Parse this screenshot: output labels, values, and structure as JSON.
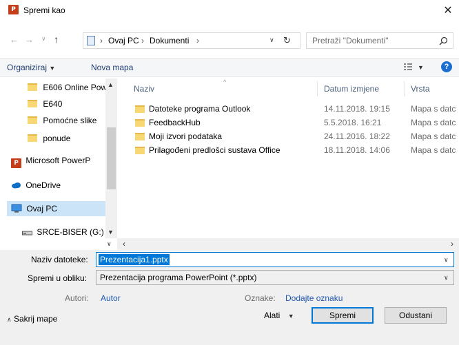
{
  "window": {
    "title": "Spremi kao",
    "app_icon": "powerpoint-icon",
    "close": "✕"
  },
  "nav": {
    "breadcrumb": [
      "Ovaj PC",
      "Dokumenti"
    ],
    "search_placeholder": "Pretraži \"Dokumenti\""
  },
  "toolbar": {
    "organize": "Organiziraj",
    "new_folder": "Nova mapa",
    "help": "?"
  },
  "sidebar": {
    "items": [
      {
        "label": "E606 Online Pow",
        "icon": "folder-icon"
      },
      {
        "label": "E640",
        "icon": "folder-icon"
      },
      {
        "label": "Pomoćne slike",
        "icon": "folder-icon"
      },
      {
        "label": "ponude",
        "icon": "folder-icon"
      },
      {
        "label": "Microsoft PowerP",
        "icon": "powerpoint-icon"
      },
      {
        "label": "OneDrive",
        "icon": "onedrive-icon"
      },
      {
        "label": "Ovaj PC",
        "icon": "computer-icon",
        "selected": true
      },
      {
        "label": "SRCE-BISER (G:)",
        "icon": "drive-icon"
      }
    ]
  },
  "filelist": {
    "columns": [
      "Naziv",
      "Datum izmjene",
      "Vrsta"
    ],
    "rows": [
      {
        "name": "Datoteke programa Outlook",
        "date": "14.11.2018. 19:15",
        "type": "Mapa s datc"
      },
      {
        "name": "FeedbackHub",
        "date": "5.5.2018. 16:21",
        "type": "Mapa s datc"
      },
      {
        "name": "Moji izvori podataka",
        "date": "24.11.2016. 18:22",
        "type": "Mapa s datc"
      },
      {
        "name": "Prilagođeni predlošci sustava Office",
        "date": "18.11.2018. 14:06",
        "type": "Mapa s datc"
      }
    ]
  },
  "form": {
    "filename_label": "Naziv datoteke:",
    "filename_value": "Prezentacija1.pptx",
    "filetype_label": "Spremi u obliku:",
    "filetype_value": "Prezentacija programa PowerPoint (*.pptx)",
    "authors_label": "Autori:",
    "authors_value": "Autor",
    "tags_label": "Oznake:",
    "tags_value": "Dodajte oznaku"
  },
  "footer": {
    "hide_folders": "Sakrij mape",
    "tools": "Alati",
    "save": "Spremi",
    "cancel": "Odustani"
  },
  "colors": {
    "accent": "#0078d7",
    "selection": "#cce4f7",
    "folder": "#f8d775",
    "powerpoint": "#c43e1c"
  }
}
